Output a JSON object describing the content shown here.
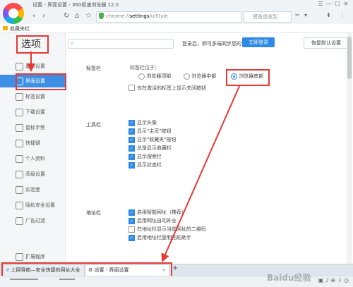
{
  "window": {
    "title": "设置 - 界面设置 - 360极速浏览器 12.0",
    "controls": [
      "☰",
      "—",
      "☐",
      "✕"
    ]
  },
  "navbar": {
    "back": "‹",
    "forward": "›",
    "reload": "↻",
    "home": "⌂",
    "star": "☆",
    "url_prefix": "chrome://",
    "url_bold": "settings",
    "url_suffix": "/uiStyle",
    "search_placeholder": "摸鱼盘收到",
    "toolbar_icons": [
      "✂",
      "▾",
      "⬇",
      "⋮"
    ]
  },
  "bookmarks": {
    "label": "收藏夹栏"
  },
  "sidebar": {
    "title": "选项",
    "items": [
      {
        "label": "基本设置",
        "icon": "gear-icon"
      },
      {
        "label": "界面设置",
        "icon": "layout-icon",
        "active": true
      },
      {
        "label": "标签设置",
        "icon": "tab-icon"
      },
      {
        "label": "下载设置",
        "icon": "download-icon"
      },
      {
        "label": "鼠标手势",
        "icon": "mouse-icon"
      },
      {
        "label": "快捷键",
        "icon": "keyboard-icon"
      },
      {
        "label": "个人资料",
        "icon": "user-icon"
      },
      {
        "label": "高级设置",
        "icon": "advanced-icon"
      },
      {
        "label": "实验室",
        "icon": "lab-icon"
      },
      {
        "label": "隐私安全设置",
        "icon": "shield-icon"
      },
      {
        "label": "广告过滤",
        "icon": "block-icon"
      }
    ],
    "extension": "扩展程序"
  },
  "header": {
    "login_hint": "登录后，即可多端同步您的设置",
    "login_button": "立即登录",
    "restore_button": "恢复默认设置"
  },
  "tab_bar_section": {
    "label": "标签栏",
    "position_label": "标签栏位于：",
    "options": [
      "浏览器顶部",
      "浏览器中部",
      "浏览器底部"
    ],
    "selected_index": 2,
    "checkbox": "仅在激活的标签上显示关闭按钮"
  },
  "toolbar_section": {
    "label": "工具栏",
    "items": [
      {
        "label": "显示头像",
        "checked": true
      },
      {
        "label": "显示\"主页\"按钮",
        "checked": true
      },
      {
        "label": "显示\"收藏夹\"按钮",
        "checked": true
      },
      {
        "label": "总是显示收藏栏",
        "checked": true
      },
      {
        "label": "显示搜索栏",
        "checked": true
      },
      {
        "label": "显示状态栏",
        "checked": true
      }
    ]
  },
  "address_section": {
    "label": "地址栏",
    "items": [
      {
        "label": "启用智能网址（推荐）",
        "checked": true
      },
      {
        "label": "启用网址自动补全",
        "checked": true
      },
      {
        "label": "在地址栏显示当前网址的二维码",
        "checked": false
      },
      {
        "label": "启用地址栏复制粘贴助手",
        "checked": true
      }
    ]
  },
  "tabs": [
    {
      "label": "上网导航—安全快捷的网址大全",
      "active": false
    },
    {
      "label": "设置 - 界面设置",
      "active": true
    }
  ],
  "new_tab": "+",
  "watermark": "Baidu经验",
  "colors": {
    "accent": "#3d8fe6",
    "annotation": "#e53935"
  }
}
